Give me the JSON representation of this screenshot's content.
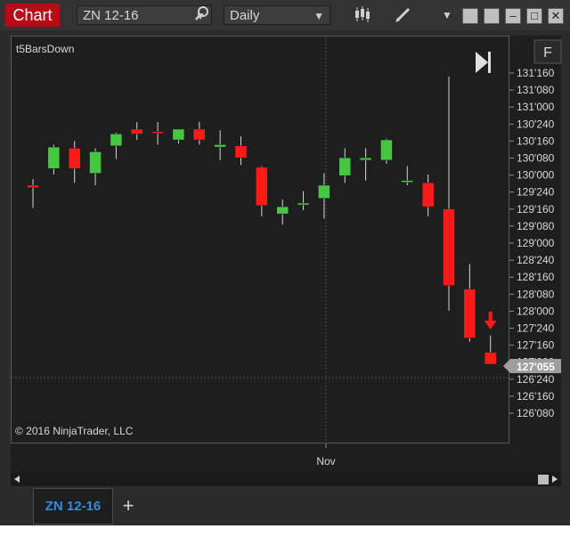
{
  "window": {
    "title": "Chart",
    "instrument": "ZN 12-16",
    "interval": "Daily"
  },
  "chart": {
    "indicator_label": "t5BarsDown",
    "copyright": "© 2016 NinjaTrader, LLC",
    "panel_button": "F",
    "x_tick": "Nov",
    "current_price_label": "127'055",
    "y_ticks": [
      "131'160",
      "131'080",
      "131'000",
      "130'240",
      "130'160",
      "130'080",
      "130'000",
      "129'240",
      "129'160",
      "129'080",
      "129'000",
      "128'240",
      "128'160",
      "128'080",
      "128'000",
      "127'240",
      "127'160",
      "127'000",
      "126'240",
      "126'160",
      "126'080"
    ]
  },
  "tabs": [
    {
      "label": "ZN 12-16"
    }
  ],
  "add_tab_label": "+",
  "chart_data": {
    "type": "candlestick",
    "x_label": "",
    "y_ticks": [
      "131'160",
      "131'080",
      "131'000",
      "130'240",
      "130'160",
      "130'080",
      "130'000",
      "129'240",
      "129'160",
      "129'080",
      "129'000",
      "128'240",
      "128'160",
      "128'080",
      "128'000",
      "127'240",
      "127'160",
      "127'000",
      "126'240",
      "126'160",
      "126'080"
    ],
    "x_ticks": [
      "Nov"
    ],
    "current_price": "127'055",
    "bars": [
      {
        "o": 6.1,
        "h": 6.6,
        "l": 4.2,
        "c": 5.9
      },
      {
        "o": 7.5,
        "h": 9.5,
        "l": 7.0,
        "c": 9.3
      },
      {
        "o": 9.2,
        "h": 9.8,
        "l": 6.3,
        "c": 7.5
      },
      {
        "o": 7.1,
        "h": 9.2,
        "l": 6.1,
        "c": 8.9
      },
      {
        "o": 9.4,
        "h": 10.5,
        "l": 8.3,
        "c": 10.4
      },
      {
        "o": 10.8,
        "h": 11.4,
        "l": 9.9,
        "c": 10.4
      },
      {
        "o": 10.6,
        "h": 11.4,
        "l": 9.5,
        "c": 10.5
      },
      {
        "o": 9.9,
        "h": 10.8,
        "l": 9.6,
        "c": 10.8
      },
      {
        "o": 10.8,
        "h": 11.4,
        "l": 9.5,
        "c": 9.9
      },
      {
        "o": 9.3,
        "h": 10.7,
        "l": 8.2,
        "c": 9.5
      },
      {
        "o": 9.4,
        "h": 10.2,
        "l": 7.8,
        "c": 8.4
      },
      {
        "o": 7.6,
        "h": 7.7,
        "l": 3.5,
        "c": 4.4
      },
      {
        "o": 3.7,
        "h": 4.9,
        "l": 2.8,
        "c": 4.3
      },
      {
        "o": 4.5,
        "h": 5.6,
        "l": 4.0,
        "c": 4.6
      },
      {
        "o": 5.0,
        "h": 7.1,
        "l": 3.3,
        "c": 6.1
      },
      {
        "o": 6.9,
        "h": 9.2,
        "l": 6.3,
        "c": 8.4
      },
      {
        "o": 8.2,
        "h": 9.2,
        "l": 6.5,
        "c": 8.4
      },
      {
        "o": 8.2,
        "h": 10.0,
        "l": 7.9,
        "c": 9.9
      },
      {
        "o": 6.5,
        "h": 7.7,
        "l": 6.1,
        "c": 6.5
      },
      {
        "o": 6.3,
        "h": 7.0,
        "l": 3.5,
        "c": 4.3
      },
      {
        "o": 4.1,
        "h": 15.2,
        "l": -4.4,
        "c": -2.3
      },
      {
        "o": -2.6,
        "h": -0.5,
        "l": -7.0,
        "c": -6.7
      },
      {
        "o": -7.9,
        "h": -6.5,
        "l": -8.4,
        "c": -8.9
      }
    ],
    "signal": {
      "type": "down-arrow",
      "bar_index": 22
    },
    "colors": {
      "up": "#46c742",
      "down": "#ff1a1a",
      "wick": "#d8d8d8",
      "text": "#d8d8d8",
      "grid": "#4a4a4a"
    }
  }
}
